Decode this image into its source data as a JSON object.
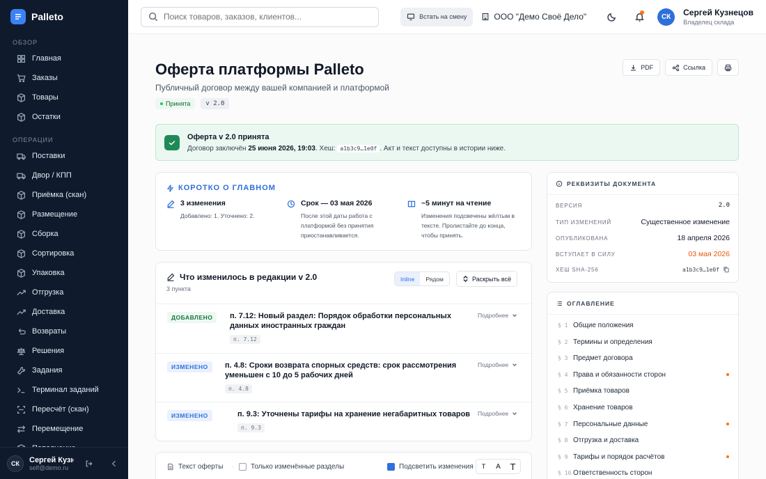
{
  "sidebar": {
    "brand": "Palleto",
    "section_overview": "ОБЗОР",
    "section_ops": "ОПЕРАЦИИ",
    "overview": [
      {
        "label": "Главная",
        "icon": "grid-icon"
      },
      {
        "label": "Заказы",
        "icon": "cart-icon"
      },
      {
        "label": "Товары",
        "icon": "box-icon"
      },
      {
        "label": "Остатки",
        "icon": "box-icon"
      }
    ],
    "ops": [
      {
        "label": "Поставки",
        "icon": "truck-icon"
      },
      {
        "label": "Двор / КПП",
        "icon": "truck-icon"
      },
      {
        "label": "Приёмка (скан)",
        "icon": "box-icon"
      },
      {
        "label": "Размещение",
        "icon": "box-icon"
      },
      {
        "label": "Сборка",
        "icon": "box-icon"
      },
      {
        "label": "Сортировка",
        "icon": "box-icon"
      },
      {
        "label": "Упаковка",
        "icon": "box-icon"
      },
      {
        "label": "Отгрузка",
        "icon": "trend-icon"
      },
      {
        "label": "Доставка",
        "icon": "trend-icon"
      },
      {
        "label": "Возвраты",
        "icon": "return-icon"
      },
      {
        "label": "Решения",
        "icon": "scale-icon"
      },
      {
        "label": "Задания",
        "icon": "wrench-icon"
      },
      {
        "label": "Терминал заданий",
        "icon": "terminal-icon"
      },
      {
        "label": "Пересчёт (скан)",
        "icon": "scan-icon"
      },
      {
        "label": "Перемещение",
        "icon": "arrows-icon"
      },
      {
        "label": "Пополнение",
        "icon": "box-icon"
      }
    ],
    "user": {
      "initials": "СК",
      "name": "Сергей Кузнецов",
      "email": "self@demo.ru"
    }
  },
  "topbar": {
    "search_placeholder": "Поиск товаров, заказов, клиентов...",
    "shift_label": "Встать на смену",
    "org": "ООО \"Демо Своё Дело\"",
    "user_initials": "СК",
    "user_name": "Сергей Кузнецов",
    "user_role": "Владелец склада"
  },
  "page": {
    "title": "Оферта платформы Palleto",
    "subtitle": "Публичный договор между вашей компанией и платформой",
    "status": "Принята",
    "version": "v 2.0",
    "actions": {
      "pdf": "PDF",
      "link": "Ссылка"
    }
  },
  "alert": {
    "title": "Оферта v 2.0 принята",
    "text_before": "Договор заключён",
    "date": "25 июня 2026, 19:03",
    "text_hash": ". Хеш:",
    "hash": "a1b3c9…1e0f",
    "text_after": ". Акт и текст доступны в истории ниже."
  },
  "summary": {
    "title": "КОРОТКО О ГЛАВНОМ",
    "cols": [
      {
        "icon": "pencil-icon",
        "head": "3 изменения",
        "text": "Добавлено: 1. Уточнено: 2."
      },
      {
        "icon": "clock-icon",
        "head": "Срок — 03 мая 2026",
        "text": "После этой даты работа с платформой без принятия приостанавливается."
      },
      {
        "icon": "book-icon",
        "head": "~5 минут на чтение",
        "text": "Изменения подсвечены жёлтым в тексте. Пролистайте до конца, чтобы принять."
      }
    ]
  },
  "changes": {
    "title": "Что изменилось в редакции v 2.0",
    "count": "3 пункта",
    "mode_inline": "Inline",
    "mode_side": "Рядом",
    "expand": "Раскрыть всё",
    "more": "Подробнее",
    "items": [
      {
        "tag": "ДОБАВЛЕНО",
        "title": "п. 7.12: Новый раздел: Порядок обработки персональных данных иностранных граждан",
        "ref": "п. 7.12"
      },
      {
        "tag": "ИЗМЕНЕНО",
        "title": "п. 4.8: Сроки возврата спорных средств: срок рассмотрения уменьшен с 10 до 5 рабочих дней",
        "ref": "п. 4.8"
      },
      {
        "tag": "ИЗМЕНЕНО",
        "title": "п. 9.3: Уточнены тарифы на хранение негабаритных товаров",
        "ref": "п. 9.3"
      }
    ]
  },
  "textbar": {
    "label": "Текст оферты",
    "only_changed": "Только изменённые разделы",
    "highlight": "Подсветить изменения",
    "highlight_checked": true
  },
  "meta": {
    "title": "РЕКВИЗИТЫ ДОКУМЕНТА",
    "rows": [
      {
        "k": "ВЕРСИЯ",
        "v": "2.0"
      },
      {
        "k": "ТИП ИЗМЕНЕНИЙ",
        "v": "Существенное изменение"
      },
      {
        "k": "ОПУБЛИКОВАНА",
        "v": "18 апреля 2026"
      },
      {
        "k": "ВСТУПАЕТ В СИЛУ",
        "v": "03 мая 2026"
      },
      {
        "k": "ХЕШ SHA-256",
        "v": "a1b3c9…1e0f"
      }
    ]
  },
  "toc": {
    "title": "ОГЛАВЛЕНИЕ",
    "items": [
      {
        "num": "§ 1",
        "label": "Общие положения",
        "changed": false
      },
      {
        "num": "§ 2",
        "label": "Термины и определения",
        "changed": false
      },
      {
        "num": "§ 3",
        "label": "Предмет договора",
        "changed": false
      },
      {
        "num": "§ 4",
        "label": "Права и обязанности сторон",
        "changed": true
      },
      {
        "num": "§ 5",
        "label": "Приёмка товаров",
        "changed": false
      },
      {
        "num": "§ 6",
        "label": "Хранение товаров",
        "changed": false
      },
      {
        "num": "§ 7",
        "label": "Персональные данные",
        "changed": true
      },
      {
        "num": "§ 8",
        "label": "Отгрузка и доставка",
        "changed": false
      },
      {
        "num": "§ 9",
        "label": "Тарифы и порядок расчётов",
        "changed": true
      },
      {
        "num": "§ 10",
        "label": "Ответственность сторон",
        "changed": false
      }
    ]
  },
  "colors": {
    "accent": "#2f6fdc",
    "success": "#1f8a57",
    "warning": "#ea580c",
    "sidebar": "#0f1b2d"
  }
}
